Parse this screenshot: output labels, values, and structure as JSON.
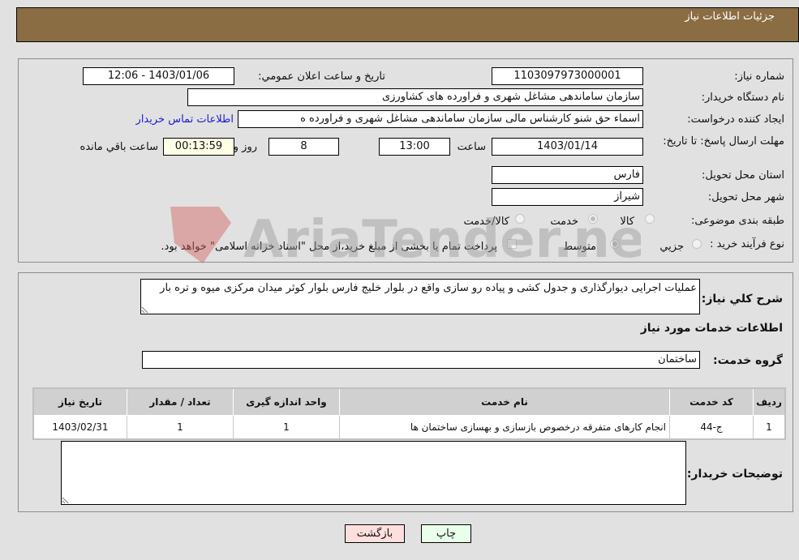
{
  "header": {
    "title": "جزئیات اطلاعات نیاز"
  },
  "fields": {
    "need_number": {
      "label": "شماره نیاز:",
      "value": "1103097973000001"
    },
    "announce_datetime": {
      "label": "تاریخ و ساعت اعلان عمومي:",
      "value": "1403/01/06 - 12:06"
    },
    "buyer_org": {
      "label": "نام دستگاه خریدار:",
      "value": "سازمان ساماندهی مشاغل شهری و فراورده های کشاورزی"
    },
    "requester": {
      "label": "ایجاد کننده درخواست:",
      "value": "اسماء حق شنو کارشناس مالی  سازمان ساماندهی مشاغل شهری و فراورده ه"
    },
    "buyer_contact_link": "اطلاعات تماس خریدار",
    "deadline": {
      "label": "مهلت ارسال پاسخ: تا تاریخ:",
      "date": "1403/01/14",
      "time_label": "ساعت",
      "time": "13:00",
      "days": "8",
      "days_label": "روز و",
      "remaining": "00:13:59",
      "remaining_label": "ساعت باقي مانده"
    },
    "province": {
      "label": "استان محل تحویل:",
      "value": "فارس"
    },
    "city": {
      "label": "شهر محل تحویل:",
      "value": "شیراز"
    },
    "category": {
      "label": "طبقه بندی موضوعی:",
      "options": [
        "کالا",
        "خدمت",
        "کالا/خدمت"
      ],
      "selected": "خدمت"
    },
    "purchase_type": {
      "label": "نوع فرآیند خرید :",
      "options": [
        "جزيي",
        "متوسط"
      ],
      "selected": "متوسط",
      "treasury_note": "پرداخت تمام یا بخشی از مبلغ خرید،از محل \"اسناد خزانه اسلامی\" خواهد بود."
    }
  },
  "description": {
    "label": "شرح کلي نیاز:",
    "value": "عملیات اجرایی دیوارگذاری و جدول کشی و پیاده رو سازی واقع در بلوار خلیج فارس بلوار کوثر میدان مرکزی میوه و تره بار"
  },
  "services_section_title": "اطلاعات خدمات مورد نیاز",
  "service_group": {
    "label": "گروه خدمت:",
    "value": "ساختمان"
  },
  "table": {
    "headers": [
      "ردیف",
      "کد خدمت",
      "نام خدمت",
      "واحد اندازه گیری",
      "تعداد / مقدار",
      "تاریخ نیاز"
    ],
    "rows": [
      [
        "1",
        "ج-44",
        "انجام کارهای متفرقه درخصوص بازسازی و بهسازی ساختمان ها",
        "1",
        "1",
        "1403/02/31"
      ]
    ]
  },
  "buyer_notes": {
    "label": "توضیحات خریدار:",
    "value": ""
  },
  "buttons": {
    "print": "چاپ",
    "back": "بازگشت"
  },
  "watermark": "AriaTender.neT"
}
